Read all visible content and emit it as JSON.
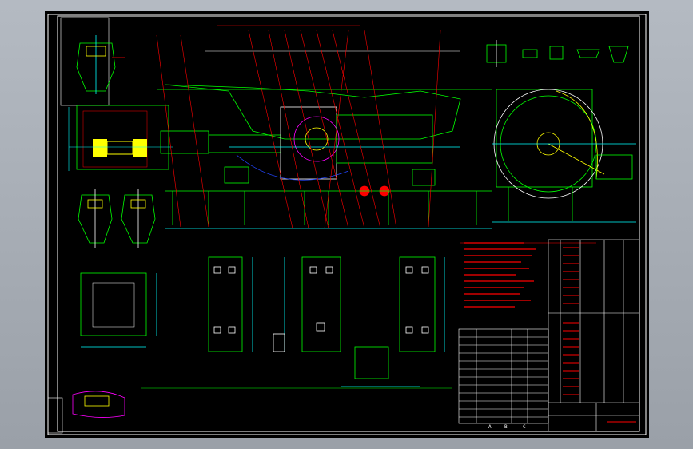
{
  "app": {
    "window_title": "",
    "background_color": "#a3a9b1",
    "sheet_color": "#000000"
  },
  "drawing": {
    "colors": {
      "frame": "#ffffff",
      "outline": "#00ff00",
      "leader": "#ff0000",
      "dimension": "#00ffff",
      "yellow": "#ffff00",
      "magenta": "#ff00ff",
      "blue": "#2244ff"
    },
    "bottom_letters": [
      "A",
      "B",
      "C"
    ]
  }
}
